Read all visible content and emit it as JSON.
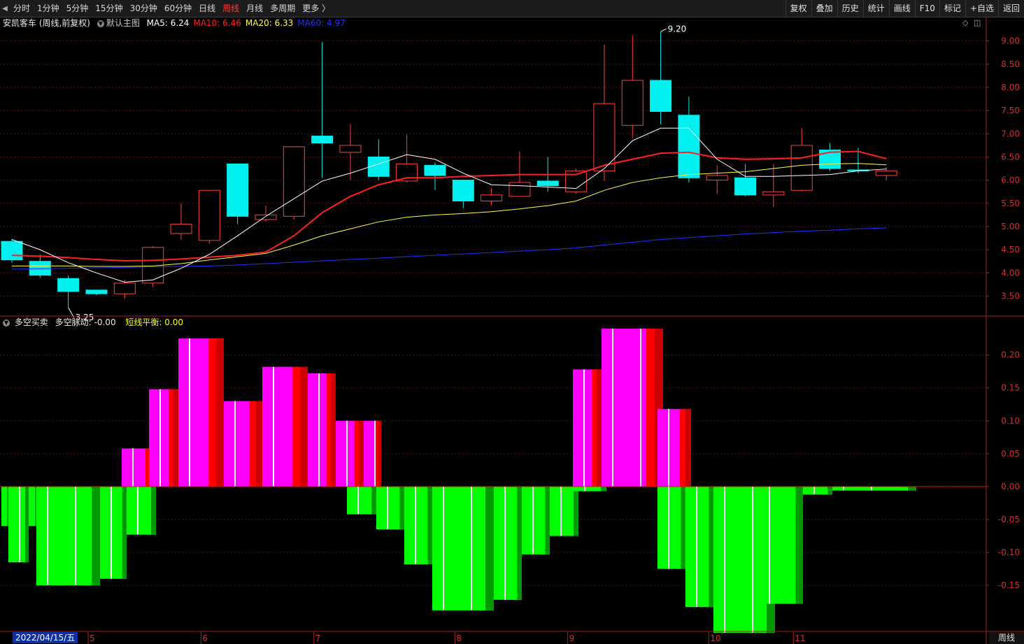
{
  "toolbar": {
    "periods": [
      "分时",
      "1分钟",
      "5分钟",
      "15分钟",
      "30分钟",
      "60分钟",
      "日线",
      "周线",
      "月线",
      "多周期",
      "更多 〉"
    ],
    "active_period": "周线",
    "right_buttons": [
      "复权",
      "叠加",
      "历史",
      "统计",
      "画线",
      "F10",
      "标记",
      "+自选",
      "返回"
    ]
  },
  "main_panel": {
    "stock_title": "安凯客车 (周线,前复权)",
    "template": "默认主图",
    "ma": [
      {
        "label": "MA5: 6.24",
        "color": "#ffffff"
      },
      {
        "label": "MA10: 6.46",
        "color": "#ff2020"
      },
      {
        "label": "MA20: 6.33",
        "color": "#ffff40"
      },
      {
        "label": "MA60: 4.97",
        "color": "#2030ff"
      }
    ]
  },
  "indicator_panel": {
    "name": "多空买卖",
    "line1": "多空脉动: -0.00",
    "line2": "短线平衡: 0.00",
    "line2_color": "#ffff00"
  },
  "colors": {
    "up": "#ff4040",
    "down": "#00f0f0",
    "pos_fill": "#ff00ff",
    "pos_edge": "#ff0000",
    "pos_edge_dark": "#cc0000",
    "neg_fill": "#00ff00",
    "neg_edge": "#009900",
    "axis": "#a02020",
    "grid": "#5a1010",
    "tick_text": "#d03030"
  },
  "footer": {
    "date_cursor": "2022/04/15/五",
    "period_label": "周线"
  },
  "chart_data": [
    {
      "type": "candlestick",
      "title": "安凯客车 (周线,前复权)",
      "ylim": [
        3.1,
        9.25
      ],
      "yticks": [
        "9.00",
        "8.50",
        "8.00",
        "7.50",
        "7.00",
        "6.50",
        "6.00",
        "5.50",
        "5.00",
        "4.50",
        "4.00",
        "3.50"
      ],
      "month_labels": [
        {
          "i": 3.2,
          "label": "5"
        },
        {
          "i": 7.2,
          "label": "6"
        },
        {
          "i": 11.2,
          "label": "7"
        },
        {
          "i": 16.2,
          "label": "8"
        },
        {
          "i": 20.2,
          "label": "9"
        },
        {
          "i": 25.2,
          "label": "10"
        },
        {
          "i": 28.2,
          "label": "11"
        }
      ],
      "annotations": [
        {
          "i": 23,
          "price": 9.2,
          "label": "9.20"
        },
        {
          "i": 2,
          "price": 3.25,
          "label": "3.25"
        }
      ],
      "candles": [
        [
          4.68,
          4.28,
          4.73,
          4.22
        ],
        [
          4.25,
          3.95,
          4.4,
          3.9
        ],
        [
          3.88,
          3.6,
          3.95,
          3.25
        ],
        [
          3.63,
          3.55,
          3.63,
          3.52
        ],
        [
          3.55,
          3.78,
          3.85,
          3.45
        ],
        [
          3.78,
          4.55,
          4.58,
          3.7
        ],
        [
          4.85,
          5.05,
          5.5,
          4.72
        ],
        [
          4.7,
          5.78,
          5.78,
          4.63
        ],
        [
          6.35,
          5.22,
          6.35,
          5.05
        ],
        [
          5.15,
          5.25,
          5.45,
          5.1
        ],
        [
          5.22,
          6.72,
          6.72,
          5.15
        ],
        [
          6.95,
          6.8,
          8.98,
          6.05
        ],
        [
          6.6,
          6.75,
          7.2,
          6.0
        ],
        [
          6.5,
          6.08,
          6.88,
          6.0
        ],
        [
          5.98,
          6.35,
          6.98,
          5.95
        ],
        [
          6.32,
          6.1,
          6.38,
          5.78
        ],
        [
          6.0,
          5.55,
          6.0,
          5.4
        ],
        [
          5.55,
          5.68,
          5.82,
          5.45
        ],
        [
          5.65,
          5.95,
          6.62,
          5.65
        ],
        [
          5.98,
          5.88,
          6.5,
          5.75
        ],
        [
          5.75,
          6.2,
          6.25,
          5.7
        ],
        [
          6.2,
          7.65,
          8.92,
          5.98
        ],
        [
          7.18,
          8.15,
          9.12,
          6.9
        ],
        [
          8.15,
          7.48,
          9.2,
          7.2
        ],
        [
          7.4,
          6.05,
          7.8,
          5.95
        ],
        [
          6.0,
          6.1,
          6.32,
          5.7
        ],
        [
          6.05,
          5.68,
          6.35,
          5.65
        ],
        [
          5.68,
          5.75,
          6.35,
          5.42
        ],
        [
          5.78,
          6.75,
          7.12,
          5.75
        ],
        [
          6.65,
          6.25,
          6.8,
          6.2
        ],
        [
          6.22,
          6.2,
          6.7,
          6.15
        ],
        [
          6.1,
          6.2,
          6.28,
          6.0
        ]
      ],
      "ma5": [
        4.72,
        4.5,
        4.22,
        4.0,
        3.8,
        3.85,
        4.1,
        4.4,
        4.8,
        5.22,
        5.6,
        5.98,
        6.15,
        6.35,
        6.55,
        6.45,
        6.15,
        5.9,
        5.88,
        5.85,
        5.82,
        6.25,
        6.85,
        7.12,
        7.12,
        6.45,
        6.08,
        6.08,
        6.1,
        6.12,
        6.2,
        6.24
      ],
      "ma10": [
        4.38,
        4.36,
        4.33,
        4.29,
        4.26,
        4.27,
        4.3,
        4.34,
        4.38,
        4.45,
        4.8,
        5.3,
        5.65,
        5.9,
        6.05,
        6.05,
        6.08,
        6.1,
        6.12,
        6.12,
        6.12,
        6.32,
        6.45,
        6.58,
        6.6,
        6.48,
        6.45,
        6.46,
        6.48,
        6.6,
        6.62,
        6.46
      ],
      "ma20": [
        4.15,
        4.15,
        4.15,
        4.14,
        4.14,
        4.15,
        4.2,
        4.28,
        4.35,
        4.42,
        4.6,
        4.8,
        4.95,
        5.1,
        5.2,
        5.25,
        5.28,
        5.32,
        5.38,
        5.45,
        5.55,
        5.78,
        5.95,
        6.05,
        6.12,
        6.15,
        6.18,
        6.25,
        6.32,
        6.35,
        6.36,
        6.33
      ],
      "ma60": [
        4.08,
        4.09,
        4.1,
        4.11,
        4.12,
        4.13,
        4.14,
        4.15,
        4.17,
        4.2,
        4.23,
        4.26,
        4.29,
        4.32,
        4.35,
        4.38,
        4.41,
        4.44,
        4.47,
        4.5,
        4.54,
        4.6,
        4.66,
        4.72,
        4.76,
        4.8,
        4.84,
        4.87,
        4.9,
        4.92,
        4.95,
        4.97
      ]
    },
    {
      "type": "bar",
      "title": "多空买卖",
      "ylim": [
        -0.22,
        0.24
      ],
      "yticks": [
        "0.20",
        "0.15",
        "0.10",
        "0.05",
        "0.00",
        "-0.05",
        "-0.10",
        "-0.15"
      ],
      "zero_line_color": "#ff0000",
      "bars": [
        {
          "x0": 2,
          "x1": 12,
          "top": 0,
          "bottom": -0.06
        },
        {
          "x0": 12,
          "x1": 41,
          "top": 0,
          "bottom": -0.115
        },
        {
          "x0": 41,
          "x1": 52,
          "top": 0,
          "bottom": -0.06
        },
        {
          "x0": 52,
          "x1": 143,
          "top": 0,
          "bottom": -0.15
        },
        {
          "x0": 143,
          "x1": 181,
          "top": 0,
          "bottom": -0.14
        },
        {
          "x0": 181,
          "x1": 223,
          "top": 0,
          "bottom": -0.073
        },
        {
          "x0": 174,
          "x1": 225,
          "top": 0.058,
          "bottom": 0
        },
        {
          "x0": 213,
          "x1": 255,
          "top": 0.148,
          "bottom": 0
        },
        {
          "x0": 255,
          "x1": 320,
          "top": 0.225,
          "bottom": 0
        },
        {
          "x0": 320,
          "x1": 375,
          "top": 0.13,
          "bottom": 0
        },
        {
          "x0": 375,
          "x1": 440,
          "top": 0.182,
          "bottom": 0
        },
        {
          "x0": 440,
          "x1": 480,
          "top": 0.172,
          "bottom": 0
        },
        {
          "x0": 480,
          "x1": 520,
          "top": 0.1,
          "bottom": 0
        },
        {
          "x0": 520,
          "x1": 545,
          "top": 0.1,
          "bottom": 0
        },
        {
          "x0": 496,
          "x1": 538,
          "top": 0,
          "bottom": -0.042
        },
        {
          "x0": 538,
          "x1": 578,
          "top": 0,
          "bottom": -0.065
        },
        {
          "x0": 578,
          "x1": 618,
          "top": 0,
          "bottom": -0.118
        },
        {
          "x0": 618,
          "x1": 706,
          "top": 0,
          "bottom": -0.188
        },
        {
          "x0": 706,
          "x1": 746,
          "top": 0,
          "bottom": -0.172
        },
        {
          "x0": 746,
          "x1": 786,
          "top": 0,
          "bottom": -0.103
        },
        {
          "x0": 786,
          "x1": 827,
          "top": 0,
          "bottom": -0.075
        },
        {
          "x0": 819,
          "x1": 860,
          "top": 0.178,
          "bottom": 0
        },
        {
          "x0": 860,
          "x1": 948,
          "top": 0.24,
          "bottom": 0
        },
        {
          "x0": 940,
          "x1": 988,
          "top": 0.118,
          "bottom": 0
        },
        {
          "x0": 820,
          "x1": 867,
          "top": 0,
          "bottom": -0.007
        },
        {
          "x0": 940,
          "x1": 980,
          "top": 0,
          "bottom": -0.125
        },
        {
          "x0": 980,
          "x1": 1020,
          "top": 0,
          "bottom": -0.183
        },
        {
          "x0": 1020,
          "x1": 1108,
          "top": 0,
          "bottom": -0.222
        },
        {
          "x0": 1084,
          "x1": 1148,
          "top": 0,
          "bottom": -0.178
        },
        {
          "x0": 1148,
          "x1": 1190,
          "top": 0,
          "bottom": -0.012
        },
        {
          "x0": 1190,
          "x1": 1310,
          "top": 0,
          "bottom": -0.006
        }
      ]
    }
  ]
}
